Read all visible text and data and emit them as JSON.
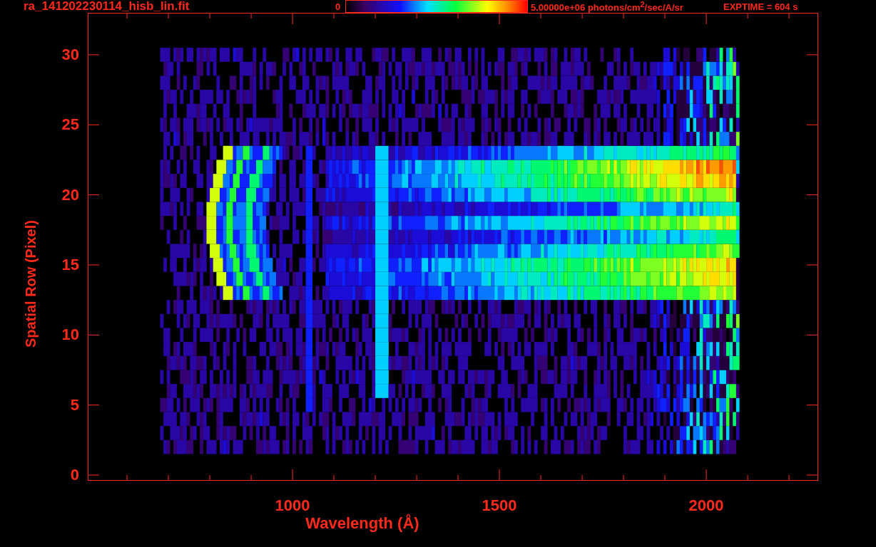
{
  "header": {
    "filename": "ra_141202230114_hisb_lin.fit",
    "exptime": "EXPTIME = 604 s"
  },
  "colorbar": {
    "min_label": "0",
    "max_label": "5.00000e+06 photons/cm$^{2}$/sec/A/sr"
  },
  "y_axis": {
    "label": "Spatial Row (Pixel)",
    "ticks": [
      "30",
      "25",
      "20",
      "15",
      "10",
      "5",
      "0"
    ]
  },
  "x_axis": {
    "label": "Wavelength (Å)",
    "ticks": [
      "1000",
      "1500",
      "2000"
    ]
  }
}
